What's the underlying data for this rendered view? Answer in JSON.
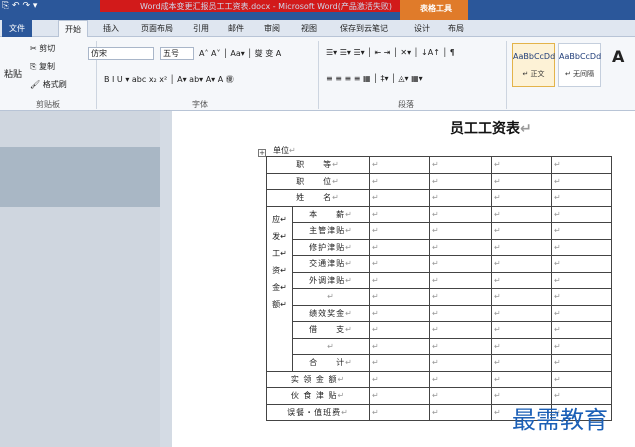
{
  "titlebar": {
    "title": "Word成本变更汇报员工工资表.docx - Microsoft Word(产品激活失败)",
    "quick_access": "⎘ ↶ ↷ ▾",
    "contextual_tab_group": "表格工具"
  },
  "tabs": [
    "文件",
    "开始",
    "插入",
    "页面布局",
    "引用",
    "邮件",
    "审阅",
    "视图",
    "保存到云笔记",
    "设计",
    "布局"
  ],
  "ribbon": {
    "clipboard": {
      "paste": "粘贴",
      "cut": "✂ 剪切",
      "copy": "⎘ 复制",
      "format_painter": "🖌 格式刷",
      "group_label": "剪贴板"
    },
    "font": {
      "name": "仿宋",
      "size": "五号",
      "group_label": "字体",
      "row1_tools": "A˄ A˅ │ Aa▾ │ 燮 变 A",
      "row2_tools": "B  I  U ▾ abc  x₂  x²  │ A▾ ab▾ A▾ A ㊝"
    },
    "paragraph": {
      "group_label": "段落",
      "row1_tools": "☰▾ ☰▾ ☰▾ │ ⇤ ⇥ │ ✕▾ │ ↓A↑ │ ¶",
      "row2_tools": "≡ ≡ ≡ ≡ ▦ │ ‡▾ │ ◬▾ ▦▾"
    },
    "styles": [
      {
        "sample": "AaBbCcDd",
        "name": "↵ 正文"
      },
      {
        "sample": "AaBbCcDd",
        "name": "↵ 无间隔"
      }
    ],
    "big_a": "A"
  },
  "document": {
    "title": "员工工资表",
    "unit_label": "单位",
    "para_mark": "↵",
    "rows_top": [
      {
        "label": "职　　等"
      },
      {
        "label": "职　　位"
      },
      {
        "label": "姓　　名"
      }
    ],
    "group_label": "应发工资金额",
    "group_rows": [
      {
        "label": "本　　薪"
      },
      {
        "label": "主管津贴"
      },
      {
        "label": "修护津贴"
      },
      {
        "label": "交通津贴"
      },
      {
        "label": "外调津贴"
      },
      {
        "label": ""
      },
      {
        "label": "绩效奖金"
      },
      {
        "label": "借　　支"
      },
      {
        "label": ""
      }
    ],
    "total_label": "合　　计",
    "rows_bottom": [
      {
        "label": "实 领 金 额"
      },
      {
        "label": "伙 食 津 贴"
      },
      {
        "label": "误餐・值班费"
      }
    ]
  },
  "watermark": "最需教育"
}
